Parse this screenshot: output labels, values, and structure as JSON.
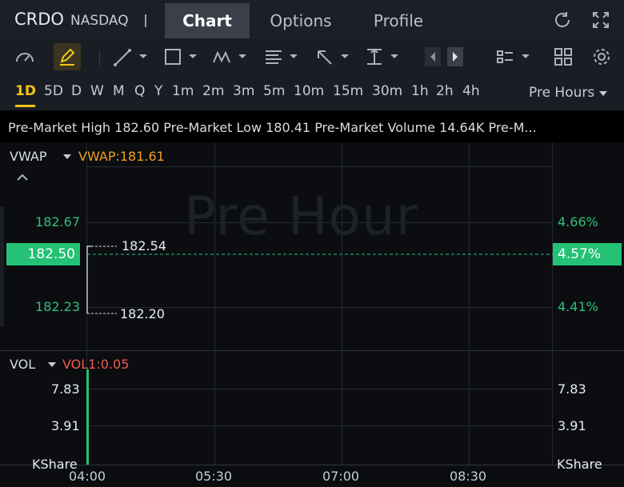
{
  "header": {
    "ticker": "CRDO",
    "exchange": "NASDAQ",
    "tabs": [
      "Chart",
      "Options",
      "Profile"
    ],
    "active_tab": "Chart"
  },
  "intervals": {
    "items": [
      "1D",
      "5D",
      "D",
      "W",
      "M",
      "Q",
      "Y",
      "1m",
      "2m",
      "3m",
      "5m",
      "10m",
      "15m",
      "30m",
      "1h",
      "2h",
      "4h"
    ],
    "active": "1D",
    "session_select": "Pre Hours"
  },
  "premarket": {
    "text": "Pre-Market High 182.60 Pre-Market Low 180.41 Pre-Market Volume 14.64K Pre-M..."
  },
  "chart": {
    "watermark": "Pre Hour",
    "vwap_label": "VWAP",
    "vwap_value": "VWAP:181.61",
    "price_left": [
      "182.67",
      "182.23"
    ],
    "price_right": [
      "4.66%",
      "4.41%"
    ],
    "current_price": "182.50",
    "current_pct": "4.57%",
    "high_annotation": "182.54",
    "low_annotation": "182.20",
    "vol_label": "VOL",
    "vol_value": "VOL1:0.05",
    "vol_left": [
      "7.83",
      "3.91"
    ],
    "vol_right": [
      "7.83",
      "3.91"
    ],
    "brand": "KShare",
    "x_ticks": [
      "04:00",
      "05:30",
      "07:00",
      "08:30"
    ],
    "colors": {
      "up": "#23c274",
      "vwap": "#f0a020",
      "vol": "#f05a4a",
      "active": "#f0c419"
    }
  }
}
